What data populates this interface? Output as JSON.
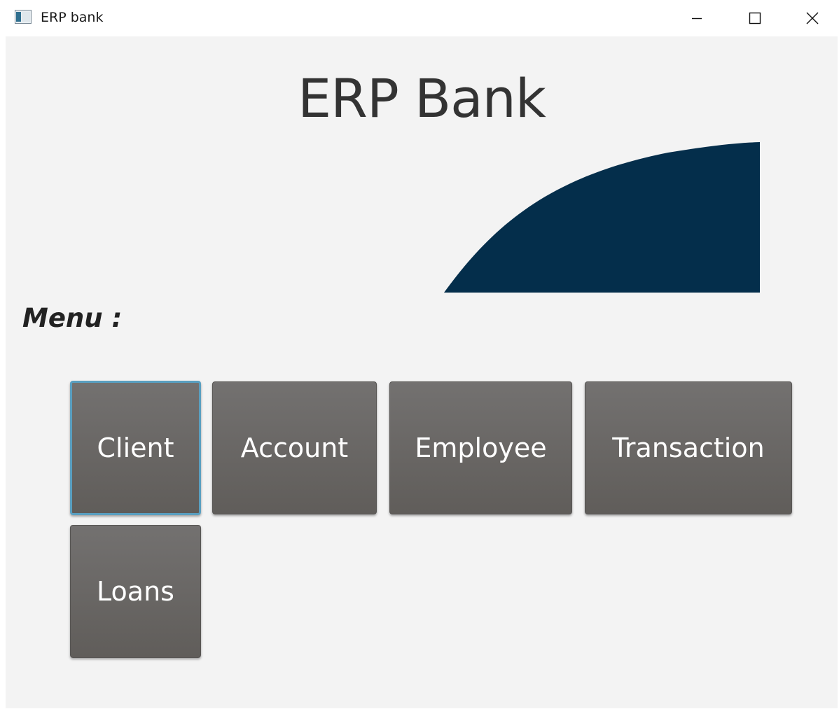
{
  "window": {
    "title": "ERP bank",
    "icon": "app-window-icon",
    "controls": [
      "minimize-icon",
      "maximize-icon",
      "close-icon"
    ]
  },
  "header": {
    "title": "ERP Bank",
    "logo": "curved-wave-logo",
    "logo_color": "#042e4b"
  },
  "menu": {
    "label": "Menu :",
    "focused": "Client",
    "items": [
      {
        "label": "Client"
      },
      {
        "label": "Account"
      },
      {
        "label": "Employee"
      },
      {
        "label": "Transaction"
      },
      {
        "label": "Loans"
      }
    ]
  },
  "colors": {
    "background": "#f3f3f3",
    "button": "#6a6866",
    "button_text": "#ffffff",
    "focus_ring": "#5a9fc0"
  }
}
